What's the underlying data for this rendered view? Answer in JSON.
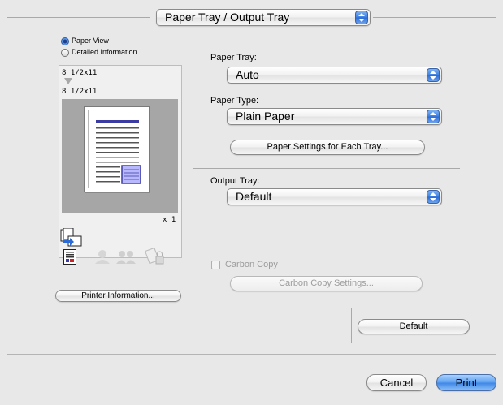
{
  "header": {
    "panel_popup": "Paper Tray / Output Tray"
  },
  "preview": {
    "view_options": [
      {
        "label": "Paper View",
        "selected": true
      },
      {
        "label": "Detailed Information",
        "selected": false
      }
    ],
    "source_size": "8 1/2x11",
    "output_size": "8 1/2x11",
    "copies": "x 1",
    "printer_info_button": "Printer Information..."
  },
  "settings": {
    "paper_tray": {
      "label": "Paper Tray:",
      "value": "Auto"
    },
    "paper_type": {
      "label": "Paper Type:",
      "value": "Plain Paper"
    },
    "paper_settings_button": "Paper Settings for Each Tray...",
    "output_tray": {
      "label": "Output Tray:",
      "value": "Default"
    },
    "carbon_copy": {
      "label": "Carbon Copy",
      "checked": false,
      "enabled": false
    },
    "carbon_copy_settings_button": "Carbon Copy Settings...",
    "default_button": "Default"
  },
  "footer": {
    "cancel": "Cancel",
    "print": "Print"
  }
}
